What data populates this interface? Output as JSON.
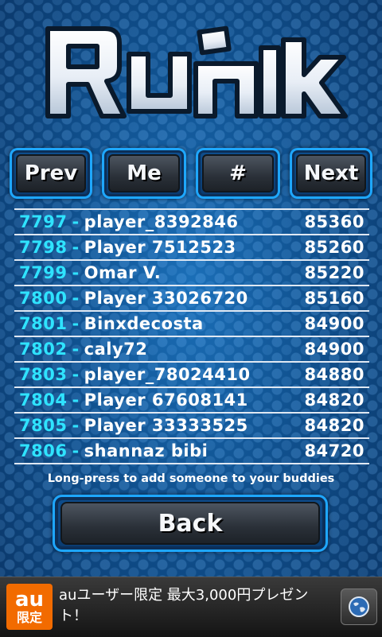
{
  "logo": {
    "text": "RUNIK"
  },
  "nav": {
    "prev_label": "Prev",
    "me_label": "Me",
    "hash_label": "#",
    "next_label": "Next"
  },
  "leaderboard": {
    "rows": [
      {
        "rank": "7797",
        "name": "player_8392846",
        "score": "85360"
      },
      {
        "rank": "7798",
        "name": "Player 7512523",
        "score": "85260"
      },
      {
        "rank": "7799",
        "name": "Omar V.",
        "score": "85220"
      },
      {
        "rank": "7800",
        "name": "Player 33026720",
        "score": "85160"
      },
      {
        "rank": "7801",
        "name": "Binxdecosta",
        "score": "84900"
      },
      {
        "rank": "7802",
        "name": "caly72",
        "score": "84900"
      },
      {
        "rank": "7803",
        "name": "player_78024410",
        "score": "84880"
      },
      {
        "rank": "7804",
        "name": "Player 67608141",
        "score": "84820"
      },
      {
        "rank": "7805",
        "name": "Player 33333525",
        "score": "84820"
      },
      {
        "rank": "7806",
        "name": "shannaz bibi",
        "score": "84720"
      }
    ],
    "separator": "-"
  },
  "hint": "Long-press to add someone to your buddies",
  "back_label": "Back",
  "ad": {
    "logo_top": "au",
    "logo_bottom": "限定",
    "text": "auユーザー限定 最大3,000円プレゼント！",
    "icon": "globe-icon"
  },
  "colors": {
    "rank": "#2fe3ff",
    "accent_border": "#1ea7ff",
    "ad_logo": "#f26b00"
  }
}
